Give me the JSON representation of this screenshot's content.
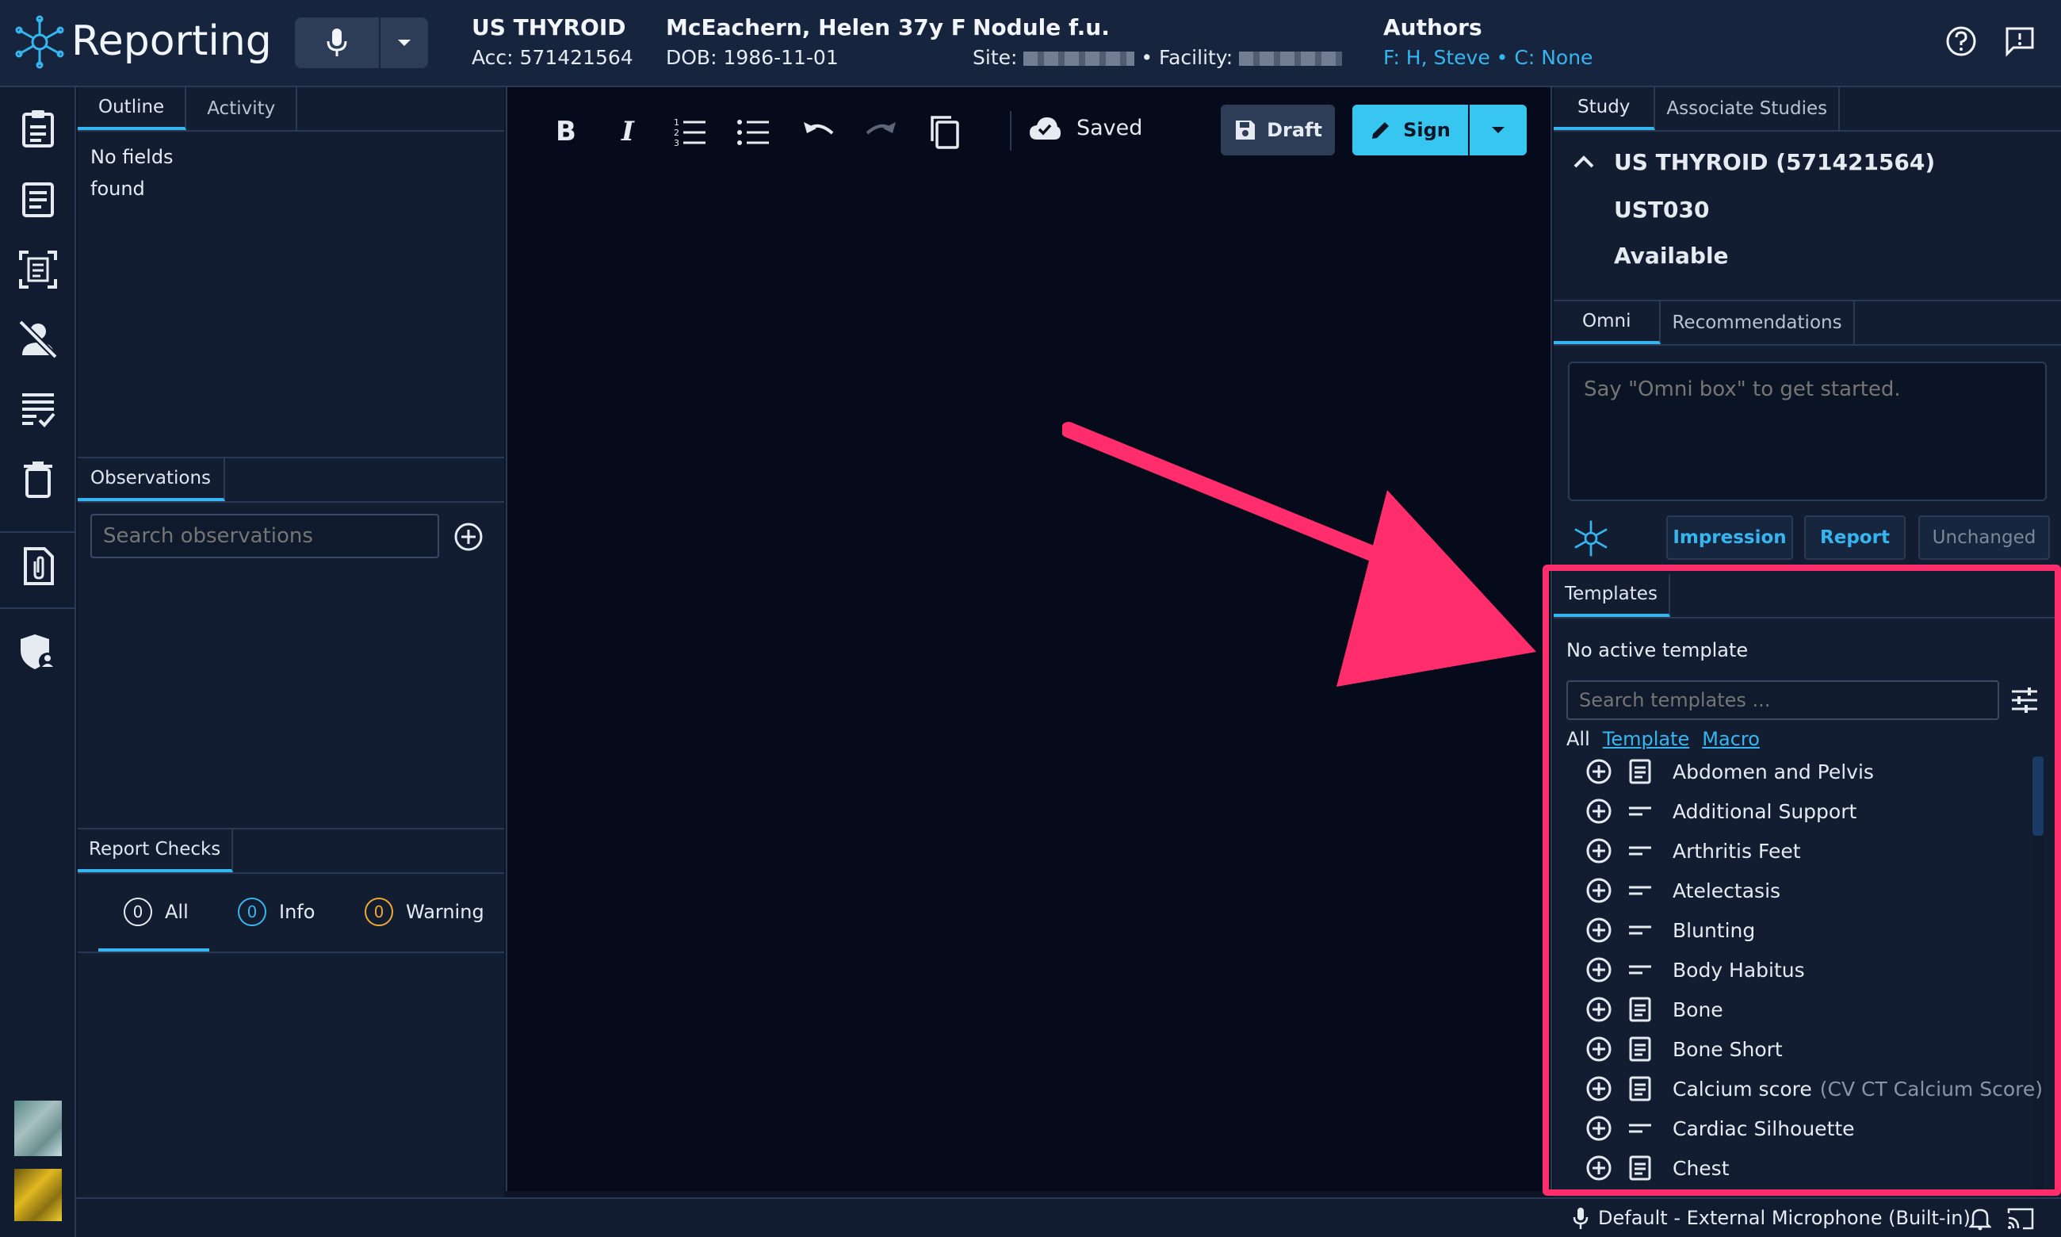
{
  "header": {
    "app_title": "Reporting",
    "study_name": "US THYROID",
    "accession": "Acc: 571421564",
    "patient_name": "McEachern, Helen 37y F",
    "dob": "DOB: 1986-11-01",
    "study_desc": "Nodule f.u.",
    "site_label": "Site:",
    "facility_label": "• Facility:",
    "authors_title": "Authors",
    "authors_value": "F: H, Steve • C: None"
  },
  "left": {
    "tabs": [
      "Outline",
      "Activity"
    ],
    "no_fields": "No fields found",
    "observations_tab": "Observations",
    "search_observations_placeholder": "Search observations",
    "report_checks_tab": "Report Checks",
    "checks": [
      {
        "count": "0",
        "label": "All",
        "color": "#e6ebf2"
      },
      {
        "count": "0",
        "label": "Info",
        "color": "#36b6f0"
      },
      {
        "count": "0",
        "label": "Warning",
        "color": "#f0a830"
      }
    ]
  },
  "editor": {
    "saved_label": "Saved",
    "draft_label": "Draft",
    "sign_label": "Sign"
  },
  "right": {
    "tabs": [
      "Study",
      "Associate Studies"
    ],
    "study_title": "US THYROID (571421564)",
    "study_code": "UST030",
    "study_status": "Available",
    "omni_tabs": [
      "Omni",
      "Recommendations"
    ],
    "omni_placeholder": "Say \"Omni box\" to get started.",
    "omni_buttons": [
      "Impression",
      "Report",
      "Unchanged"
    ],
    "templates_tab": "Templates",
    "no_active_template": "No active template",
    "search_templates_placeholder": "Search templates ...",
    "filters": [
      "All",
      "Template",
      "Macro"
    ],
    "templates": [
      {
        "name": "Abdomen and Pelvis",
        "kind": "doc",
        "note": ""
      },
      {
        "name": "Additional Support",
        "kind": "line",
        "note": ""
      },
      {
        "name": "Arthritis Feet",
        "kind": "line",
        "note": ""
      },
      {
        "name": "Atelectasis",
        "kind": "line",
        "note": ""
      },
      {
        "name": "Blunting",
        "kind": "line",
        "note": ""
      },
      {
        "name": "Body Habitus",
        "kind": "line",
        "note": ""
      },
      {
        "name": "Bone",
        "kind": "doc",
        "note": ""
      },
      {
        "name": "Bone Short",
        "kind": "doc",
        "note": ""
      },
      {
        "name": "Calcium score",
        "kind": "doc",
        "note": "(CV CT Calcium Score)"
      },
      {
        "name": "Cardiac Silhouette",
        "kind": "line",
        "note": ""
      },
      {
        "name": "Chest",
        "kind": "doc",
        "note": ""
      }
    ]
  },
  "footer": {
    "microphone": "Default - External Microphone (Built-in)"
  },
  "colors": {
    "accent": "#36b6f0",
    "highlight": "#ff2d6b",
    "sign_button": "#36c6f0"
  }
}
